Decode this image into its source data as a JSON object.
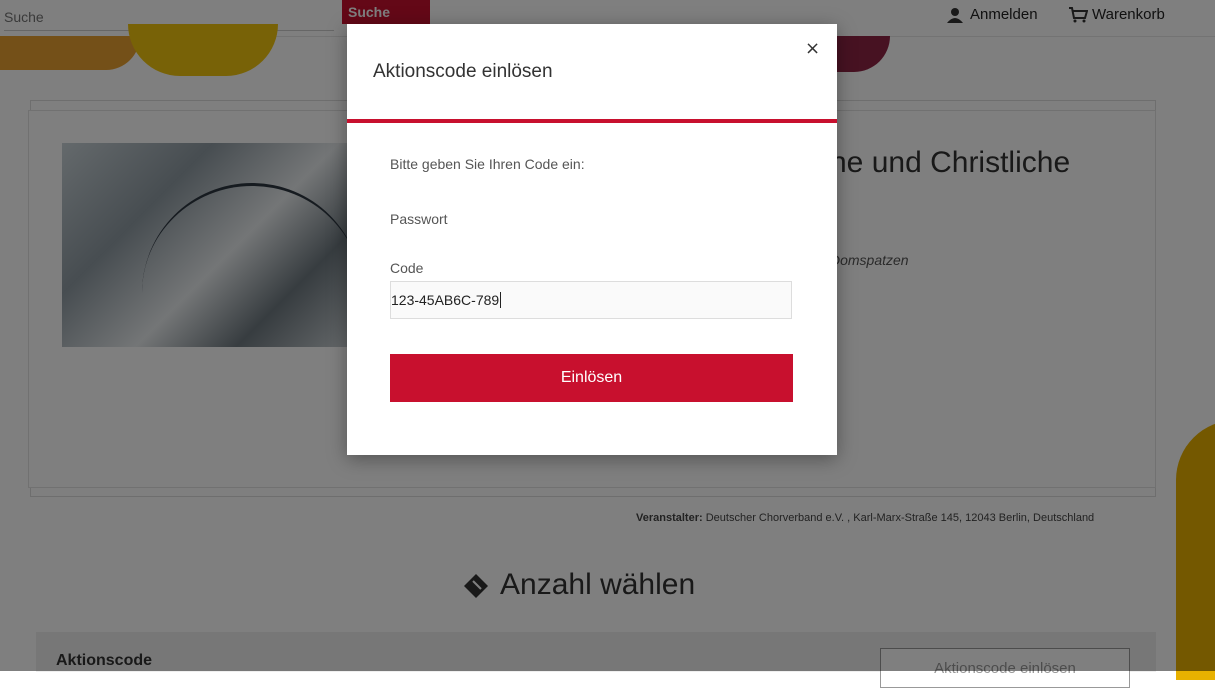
{
  "header": {
    "search_placeholder": "Suche",
    "search_button": "Suche",
    "login_label": "Anmelden",
    "cart_label": "Warenkorb"
  },
  "event": {
    "title": "ne und Christliche",
    "subtitle": "Domspatzen",
    "organizer_label": "Veranstalter:",
    "organizer_value": "Deutscher Chorverband e.V. , Karl-Marx-Straße 145, 12043 Berlin, Deutschland"
  },
  "quantity": {
    "title": "Anzahl wählen"
  },
  "promo": {
    "label": "Aktionscode",
    "button": "Aktionscode einlösen"
  },
  "modal": {
    "title": "Aktionscode einlösen",
    "close": "×",
    "intro": "Bitte geben Sie Ihren Code ein:",
    "password_label": "Passwort",
    "code_label": "Code",
    "code_value": "123-45AB6C-789",
    "submit": "Einlösen"
  },
  "colors": {
    "accent": "#c8102e",
    "overlay": "rgba(0,0,0,0.5)"
  }
}
